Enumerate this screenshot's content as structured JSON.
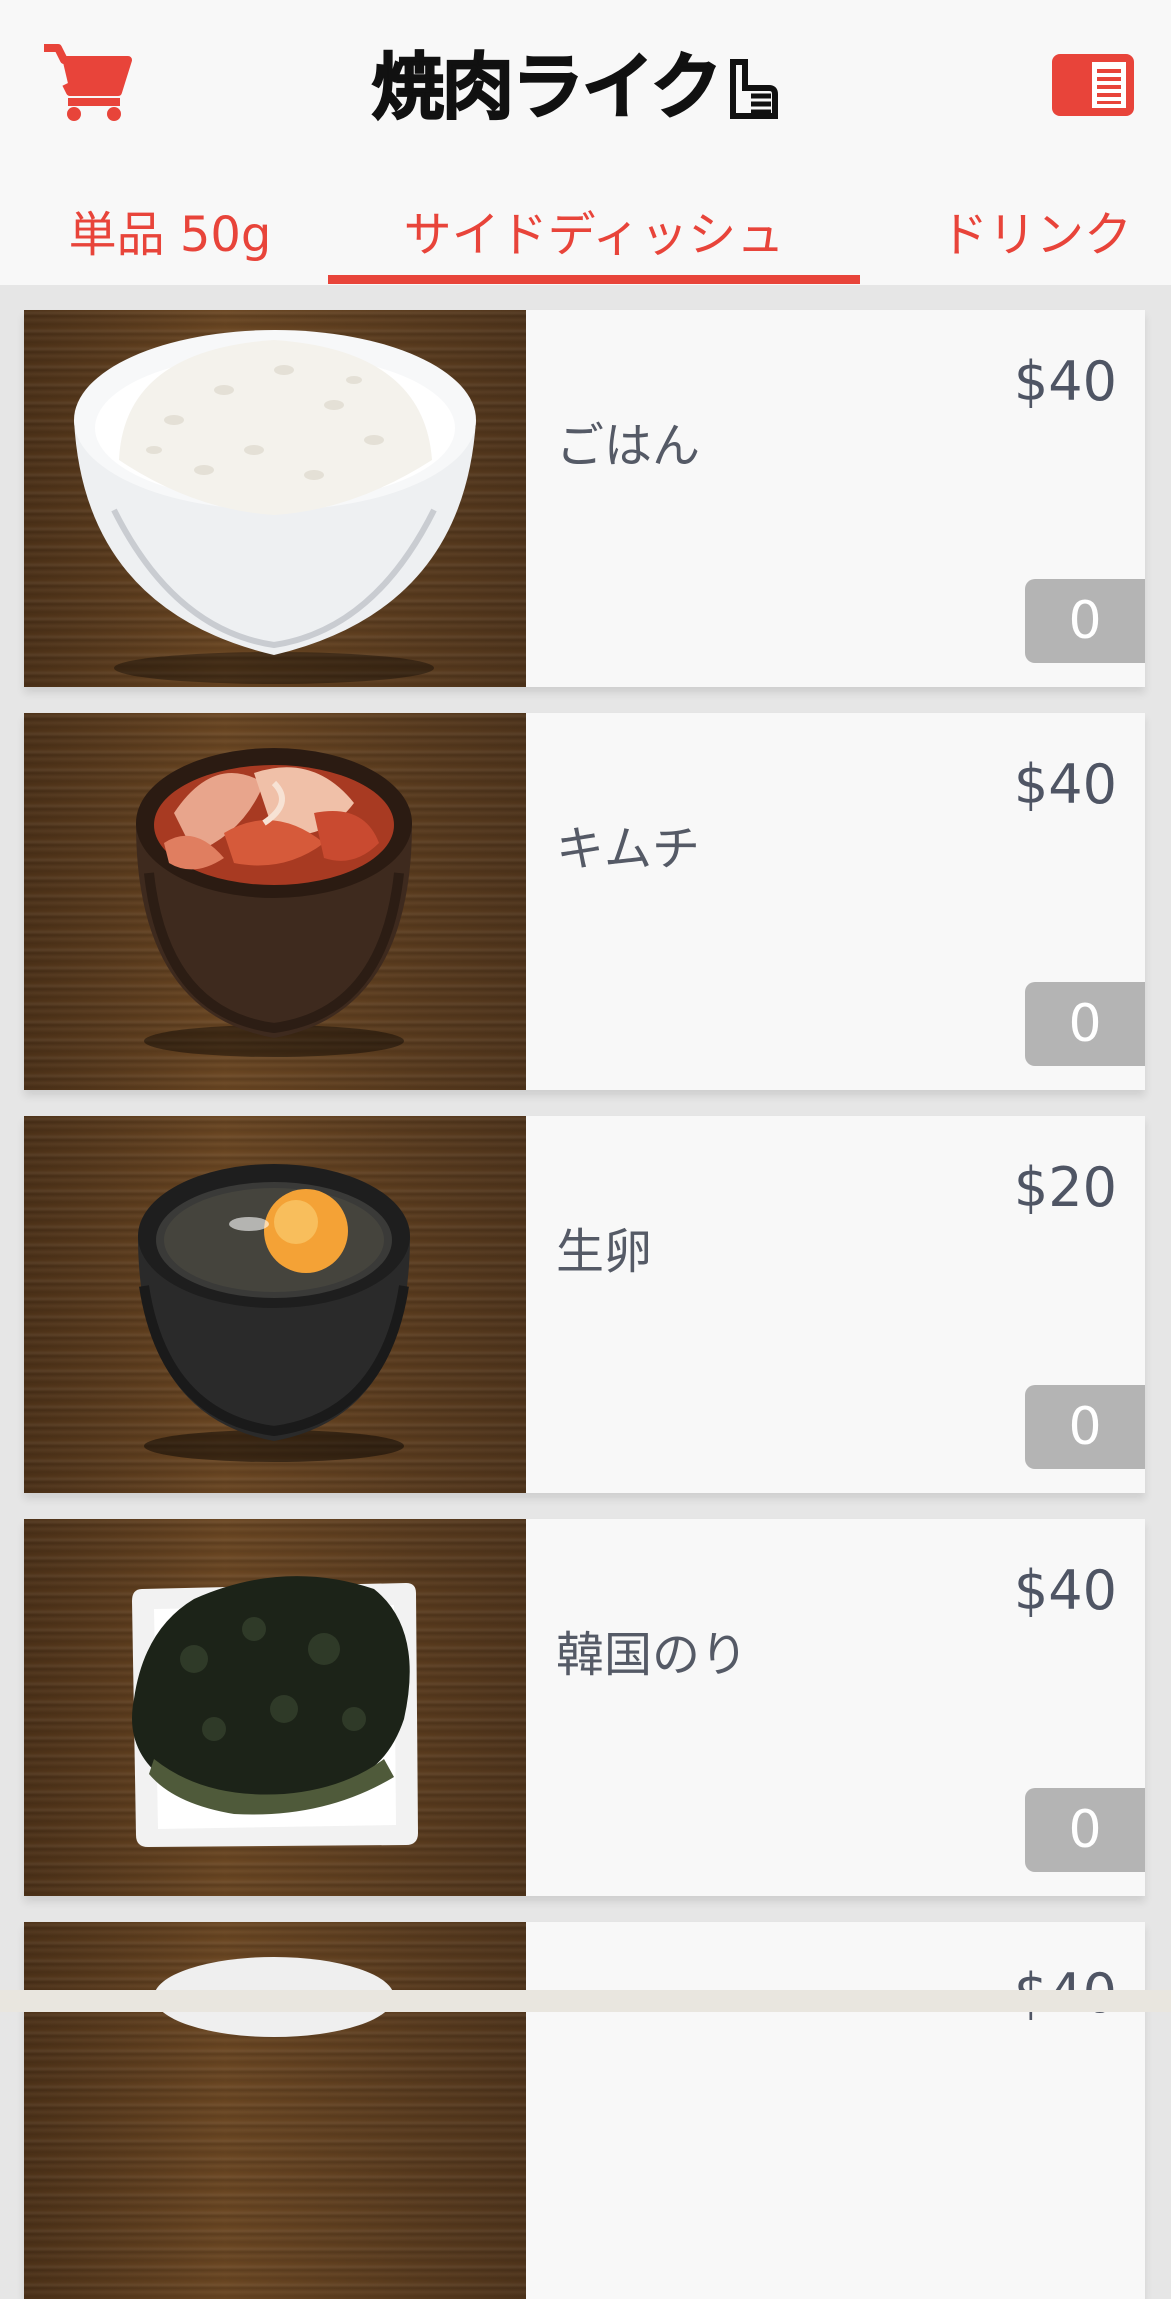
{
  "header": {
    "logo_text": "焼肉ライク",
    "cart_icon": "cart-icon",
    "menu_icon": "menu-list-icon"
  },
  "tabs": [
    {
      "label": "単品 50g",
      "active": false
    },
    {
      "label": "サイドディッシュ",
      "active": true
    },
    {
      "label": "ドリンク",
      "active": false
    }
  ],
  "items": [
    {
      "name": "ごはん",
      "price": "$40",
      "qty": "0",
      "image": "rice-bowl"
    },
    {
      "name": "キムチ",
      "price": "$40",
      "qty": "0",
      "image": "kimchi-bowl"
    },
    {
      "name": "生卵",
      "price": "$20",
      "qty": "0",
      "image": "raw-egg-bowl"
    },
    {
      "name": "韓国のり",
      "price": "$40",
      "qty": "0",
      "image": "korean-seaweed-plate"
    },
    {
      "name": "",
      "price": "$40",
      "qty": "",
      "image": "partial-item"
    }
  ],
  "colors": {
    "accent": "#e8443a",
    "text": "#555a66",
    "qty_button": "#b4b4b4",
    "background": "#e6e6e6",
    "card": "#f8f8f8"
  }
}
